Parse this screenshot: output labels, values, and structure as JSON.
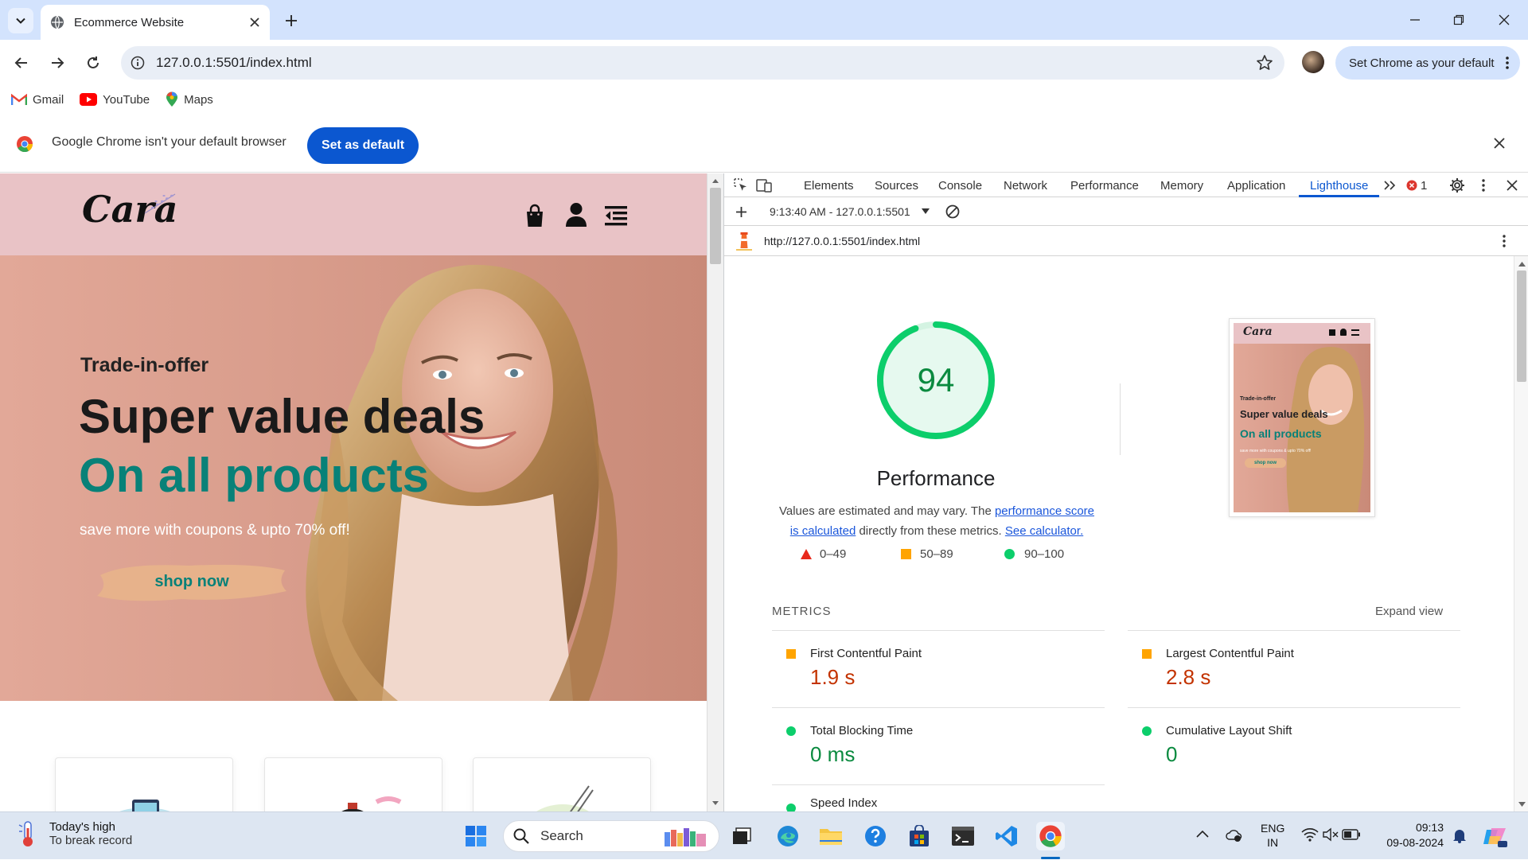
{
  "browser": {
    "tab_title": "Ecommerce Website",
    "url": "127.0.0.1:5501/index.html",
    "set_default_pill": "Set Chrome as your default",
    "bookmarks": [
      {
        "label": "Gmail",
        "icon": "gmail-icon"
      },
      {
        "label": "YouTube",
        "icon": "youtube-icon"
      },
      {
        "label": "Maps",
        "icon": "maps-icon"
      }
    ],
    "infobar_message": "Google Chrome isn't your default browser",
    "infobar_button": "Set as default"
  },
  "site": {
    "logo": "Cara",
    "hero": {
      "eyebrow": "Trade-in-offer",
      "headline1": "Super value deals",
      "headline2": "On all products",
      "subtext": "save more with coupons & upto 70% off!",
      "cta": "shop now"
    }
  },
  "devtools": {
    "tabs": [
      "Elements",
      "Sources",
      "Console",
      "Network",
      "Performance",
      "Memory",
      "Application",
      "Lighthouse"
    ],
    "active_tab": "Lighthouse",
    "error_count": "1",
    "report_selector": "9:13:40 AM - 127.0.0.1:5501",
    "report_url": "http://127.0.0.1:5501/index.html",
    "lighthouse": {
      "score": "94",
      "score_value": 94,
      "category": "Performance",
      "desc_prefix": "Values are estimated and may vary. The ",
      "desc_link1": "performance score is calculated",
      "desc_mid": " directly from these metrics. ",
      "desc_link2": "See calculator.",
      "legend": [
        {
          "range": "0–49",
          "color": "#e8291c",
          "shape": "triangle"
        },
        {
          "range": "50–89",
          "color": "#ffa400",
          "shape": "square"
        },
        {
          "range": "90–100",
          "color": "#0cce6b",
          "shape": "circle"
        }
      ],
      "metrics_label": "METRICS",
      "expand_view": "Expand view",
      "metrics": [
        {
          "name": "First Contentful Paint",
          "value": "1.9 s",
          "rating": "average"
        },
        {
          "name": "Largest Contentful Paint",
          "value": "2.8 s",
          "rating": "average"
        },
        {
          "name": "Total Blocking Time",
          "value": "0 ms",
          "rating": "pass"
        },
        {
          "name": "Cumulative Layout Shift",
          "value": "0",
          "rating": "pass"
        },
        {
          "name": "Speed Index",
          "value": "",
          "rating": "pass"
        }
      ],
      "thumbnail": {
        "logo": "Cara",
        "eyebrow": "Trade-in-offer",
        "headline1": "Super value deals",
        "headline2": "On all products",
        "subtext": "save more with coupons & upto 70% off!",
        "cta": "shop now"
      }
    }
  },
  "taskbar": {
    "weather_title": "Today's high",
    "weather_sub": "To break record",
    "search_placeholder": "Search",
    "lang_top": "ENG",
    "lang_bottom": "IN",
    "time": "09:13",
    "date": "09-08-2024"
  },
  "colors": {
    "accent": "#0b57d0",
    "brand_teal": "#088178",
    "header_pink": "#e9c3c6",
    "pass": "#0cce6b",
    "average": "#ffa400",
    "average_text": "#c33300"
  }
}
